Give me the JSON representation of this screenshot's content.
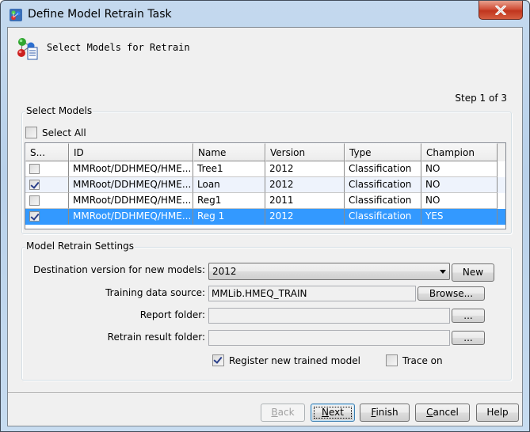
{
  "window": {
    "title": "Define Model Retrain Task",
    "icon": "model-network-icon",
    "close_icon": "close-icon"
  },
  "header": {
    "icon": "models-document-icon",
    "text": "Select Models for Retrain",
    "step": "Step 1 of 3"
  },
  "select_models": {
    "legend": "Select Models",
    "select_all_label": "Select All",
    "select_all_checked": false,
    "columns": [
      "S...",
      "ID",
      "Name",
      "Version",
      "Type",
      "Champion"
    ],
    "rows": [
      {
        "selected": false,
        "id": "MMRoot/DDHMEQ/HME...",
        "name": "Tree1",
        "version": "2012",
        "type": "Classification",
        "champion": "NO",
        "highlighted": false
      },
      {
        "selected": true,
        "id": "MMRoot/DDHMEQ/HME...",
        "name": "Loan",
        "version": "2012",
        "type": "Classification",
        "champion": "NO",
        "highlighted": false
      },
      {
        "selected": false,
        "id": "MMRoot/DDHMEQ/HME...",
        "name": "Reg1",
        "version": "2011",
        "type": "Classification",
        "champion": "NO",
        "highlighted": false
      },
      {
        "selected": true,
        "id": "MMRoot/DDHMEQ/HME...",
        "name": "Reg 1",
        "version": "2012",
        "type": "Classification",
        "champion": "YES",
        "highlighted": true
      }
    ]
  },
  "settings": {
    "legend": "Model Retrain Settings",
    "destination_label": "Destination version for new models:",
    "destination_value": "2012",
    "new_button": "New",
    "training_label": "Training data source:",
    "training_value": "MMLib.HMEQ_TRAIN",
    "browse_button": "Browse...",
    "report_label": "Report folder:",
    "report_value": "",
    "report_button": "...",
    "retrain_label": "Retrain result folder:",
    "retrain_value": "",
    "retrain_button": "...",
    "register_label": "Register new trained model",
    "register_checked": true,
    "trace_label": "Trace on",
    "trace_checked": false
  },
  "footer": {
    "back": {
      "mnemonic": "B",
      "rest": "ack",
      "enabled": false
    },
    "next": {
      "mnemonic": "N",
      "rest": "ext",
      "enabled": true
    },
    "finish": {
      "mnemonic": "F",
      "rest": "inish",
      "enabled": true
    },
    "cancel": {
      "mnemonic": "C",
      "rest": "ancel",
      "enabled": true
    },
    "help": {
      "label": "Help",
      "enabled": true
    }
  },
  "colors": {
    "selection": "#3399ff",
    "alt_row": "#eef3fc",
    "close_button": "#c9402a"
  }
}
